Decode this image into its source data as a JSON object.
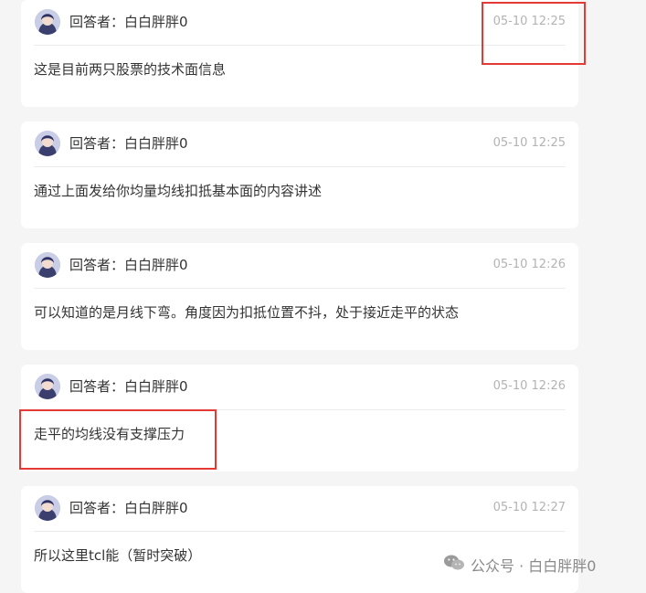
{
  "answers": [
    {
      "answerer": "回答者：白白胖胖0",
      "time": "05-10 12:25",
      "content": "这是目前两只股票的技术面信息"
    },
    {
      "answerer": "回答者：白白胖胖0",
      "time": "05-10 12:25",
      "content": "通过上面发给你均量均线扣抵基本面的内容讲述"
    },
    {
      "answerer": "回答者：白白胖胖0",
      "time": "05-10 12:26",
      "content": "可以知道的是月线下弯。角度因为扣抵位置不抖，处于接近走平的状态"
    },
    {
      "answerer": "回答者：白白胖胖0",
      "time": "05-10 12:26",
      "content": "走平的均线没有支撑压力"
    },
    {
      "answerer": "回答者：白白胖胖0",
      "time": "05-10 12:27",
      "content": "所以这里tcl能（暂时突破）"
    }
  ],
  "watermark": {
    "icon": "wechat-icon",
    "text": "公众号 · 白白胖胖0"
  },
  "colors": {
    "highlight": "#e53935",
    "time": "#b3b3b3",
    "background": "#f5f5f5"
  }
}
